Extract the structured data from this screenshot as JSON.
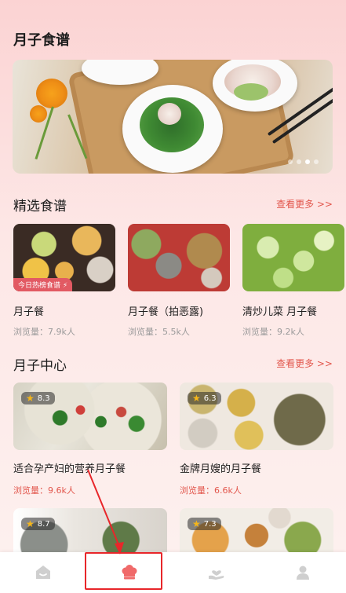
{
  "page": {
    "title": "月子食谱"
  },
  "banner": {
    "slides": 4,
    "active_slide": 1
  },
  "featured": {
    "title": "精选食谱",
    "more": "查看更多 >>",
    "items": [
      {
        "name": "月子餐",
        "views": "浏览量：7.9k人",
        "badge": "今日热榜食谱 ⚡"
      },
      {
        "name": "月子餐（拍恶露)",
        "views": "浏览量：5.5k人"
      },
      {
        "name": "清炒儿菜 月子餐",
        "views": "浏览量：9.2k人"
      }
    ]
  },
  "center": {
    "title": "月子中心",
    "more": "查看更多 >>",
    "items": [
      {
        "rating": "8.3",
        "name": "适合孕产妇的营养月子餐",
        "views": "浏览量：9.6k人"
      },
      {
        "rating": "6.3",
        "name": "金牌月嫂的月子餐",
        "views": "浏览量：6.6k人"
      },
      {
        "rating": "8.7"
      },
      {
        "rating": "7.3"
      }
    ]
  },
  "bottom_nav": {
    "items": [
      {
        "icon": "home-icon"
      },
      {
        "icon": "chef-hat-icon",
        "active": true
      },
      {
        "icon": "heart-hand-icon"
      },
      {
        "icon": "user-icon"
      }
    ]
  },
  "colors": {
    "accent": "#e2554b",
    "active_nav": "#f06a6a",
    "inactive_nav": "#cfcfcf",
    "highlight": "#e8262a"
  }
}
